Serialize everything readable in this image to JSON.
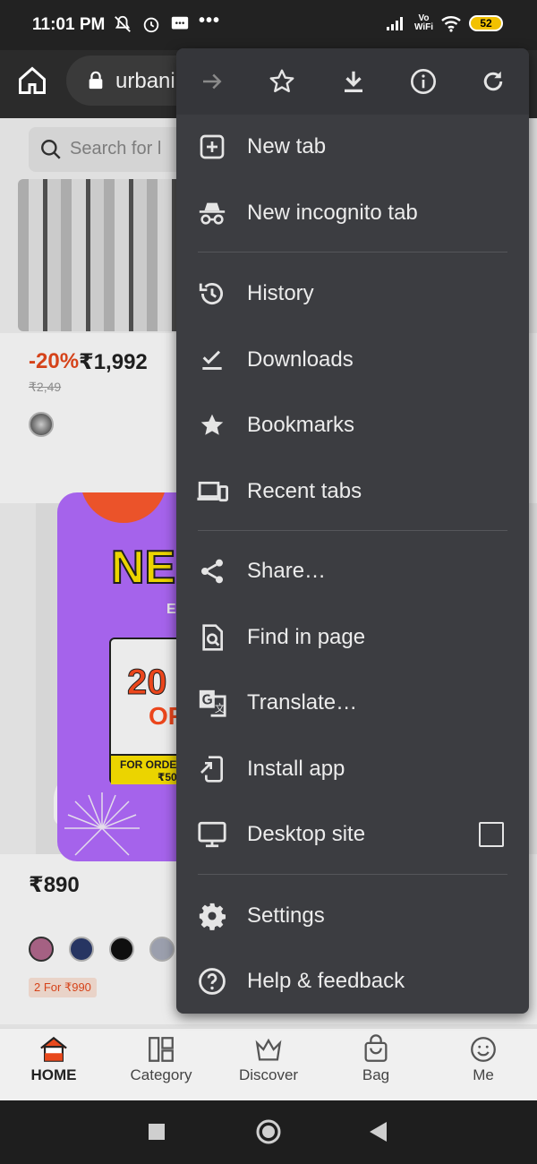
{
  "status_bar": {
    "time": "11:01 PM",
    "overflow": "•••",
    "vo_wifi_top": "Vo",
    "vo_wifi_bottom": "WiFi",
    "battery": "52"
  },
  "browser": {
    "url_text": "urbani"
  },
  "page": {
    "search_placeholder": "Search for l",
    "product1": {
      "discount": "-20%",
      "price": "₹1,992",
      "old_price": "₹2,49"
    },
    "promo_popup": {
      "headline": "NE",
      "sub": "E",
      "coupon_big": "20",
      "coupon_off": "OF",
      "coupon_condition_1": "FOR ORDE",
      "coupon_condition_2": "₹50"
    },
    "product2": {
      "price": "₹890",
      "badge": "2 For ₹990",
      "swatch_colors": [
        "#b46a8f",
        "#2b3a6b",
        "#111111",
        "#a9adbc"
      ]
    }
  },
  "bottom_nav": {
    "items": [
      {
        "label": "HOME",
        "icon": "home-icon",
        "active": true
      },
      {
        "label": "Category",
        "icon": "category-icon",
        "active": false
      },
      {
        "label": "Discover",
        "icon": "crown-icon",
        "active": false
      },
      {
        "label": "Bag",
        "icon": "bag-icon",
        "active": false
      },
      {
        "label": "Me",
        "icon": "smiley-icon",
        "active": false
      }
    ]
  },
  "menu": {
    "toolbar": [
      "forward-arrow-icon",
      "star-icon",
      "download-icon",
      "info-icon",
      "refresh-icon"
    ],
    "items": [
      {
        "label": "New tab",
        "icon": "plus-square-icon"
      },
      {
        "label": "New incognito tab",
        "icon": "incognito-icon"
      },
      {
        "label": "History",
        "icon": "history-icon"
      },
      {
        "label": "Downloads",
        "icon": "downloads-check-icon"
      },
      {
        "label": "Bookmarks",
        "icon": "star-filled-icon"
      },
      {
        "label": "Recent tabs",
        "icon": "devices-icon"
      },
      {
        "label": "Share…",
        "icon": "share-icon"
      },
      {
        "label": "Find in page",
        "icon": "find-in-page-icon"
      },
      {
        "label": "Translate…",
        "icon": "translate-icon"
      },
      {
        "label": "Install app",
        "icon": "install-app-icon"
      },
      {
        "label": "Desktop site",
        "icon": "desktop-icon",
        "checkbox_checked": false
      },
      {
        "label": "Settings",
        "icon": "gear-icon"
      },
      {
        "label": "Help & feedback",
        "icon": "help-icon"
      }
    ]
  },
  "colors": {
    "menu_bg": "#3c3d41",
    "accent_discount": "#e8491d",
    "promo_purple": "#b46cff",
    "battery_yellow": "#f2c100"
  }
}
